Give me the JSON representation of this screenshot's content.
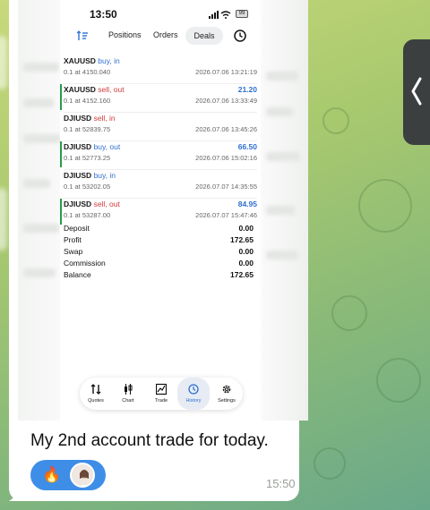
{
  "phone": {
    "status_time": "13:50",
    "battery": "99"
  },
  "tabs": {
    "positions": "Positions",
    "orders": "Orders",
    "deals": "Deals"
  },
  "deals": [
    {
      "symbol": "XAUUSD",
      "direction": "buy, in",
      "side": "buy",
      "lot": "0.1 at 4150.040",
      "profit": "",
      "datetime": "2026.07.06 13:21:19"
    },
    {
      "symbol": "XAUUSD",
      "direction": "sell, out",
      "side": "sell",
      "lot": "0.1 at 4152.160",
      "profit": "21.20",
      "datetime": "2026.07.06 13:33:49"
    },
    {
      "symbol": "DJIUSD",
      "direction": "sell, in",
      "side": "sell",
      "lot": "0.1 at 52839.75",
      "profit": "",
      "datetime": "2026.07.06 13:45:26"
    },
    {
      "symbol": "DJIUSD",
      "direction": "buy, out",
      "side": "buy",
      "lot": "0.1 at 52773.25",
      "profit": "66.50",
      "datetime": "2026.07.06 15:02:16"
    },
    {
      "symbol": "DJIUSD",
      "direction": "buy, in",
      "side": "buy",
      "lot": "0.1 at 53202.05",
      "profit": "",
      "datetime": "2026.07.07 14:35:55"
    },
    {
      "symbol": "DJIUSD",
      "direction": "sell, out",
      "side": "sell",
      "lot": "0.1 at 53287.00",
      "profit": "84.95",
      "datetime": "2026.07.07 15:47:46"
    }
  ],
  "summary": [
    {
      "key": "Deposit",
      "value": "0.00"
    },
    {
      "key": "Profit",
      "value": "172.65"
    },
    {
      "key": "Swap",
      "value": "0.00"
    },
    {
      "key": "Commission",
      "value": "0.00"
    },
    {
      "key": "Balance",
      "value": "172.65"
    }
  ],
  "nav": {
    "quotes": "Quotes",
    "chart": "Chart",
    "trade": "Trade",
    "history": "History",
    "settings": "Settings"
  },
  "message": {
    "text": "My 2nd account trade for today.",
    "time": "15:50",
    "reaction_emoji": "🔥"
  },
  "colors": {
    "buy": "#2f6fcf",
    "sell": "#d33b3b",
    "reaction_bg": "#3e8ee8",
    "out_bar": "#2a9a4a"
  }
}
